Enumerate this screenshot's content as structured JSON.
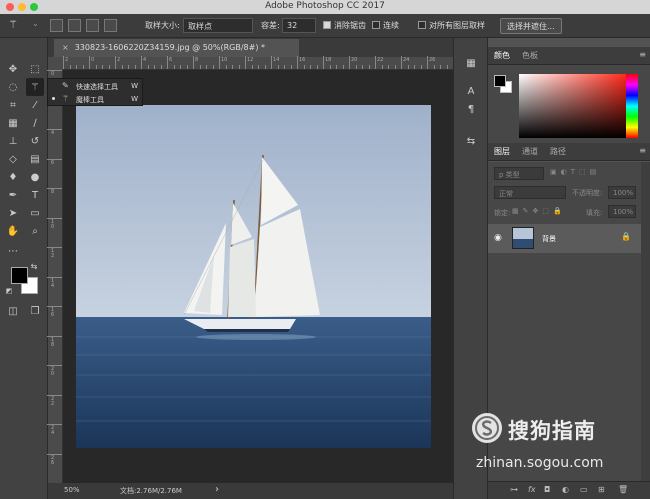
{
  "window": {
    "title": "Adobe Photoshop CC 2017",
    "traffic_colors": [
      "#fd5d57",
      "#febb2e",
      "#2ac840"
    ]
  },
  "options_bar": {
    "sample_size_label": "取样大小:",
    "sample_size_value": "取样点",
    "tolerance_label": "容差:",
    "tolerance_value": "32",
    "antialias_label": "消除锯齿",
    "antialias_checked": true,
    "contiguous_label": "连续",
    "all_layers_label": "对所有图层取样",
    "select_subject_label": "选择并遮住..."
  },
  "flyout": {
    "items": [
      {
        "label": "快速选择工具",
        "shortcut": "W",
        "icon": "quick-selection-icon"
      },
      {
        "label": "魔棒工具",
        "shortcut": "W",
        "icon": "magic-wand-icon"
      }
    ]
  },
  "document": {
    "tab_label": "330823-1606220Z34159.jpg @ 50%(RGB/8#) *",
    "close_glyph": "×",
    "ruler_h_labels": [
      "2",
      "0",
      "2",
      "4",
      "6",
      "8",
      "10",
      "12",
      "14",
      "16",
      "18",
      "20",
      "22",
      "24",
      "26"
    ],
    "ruler_v_labels": [
      "0",
      "2",
      "4",
      "6",
      "8",
      "1 0",
      "1 2",
      "1 4",
      "1 6",
      "1 8",
      "2 0",
      "2 2",
      "2 4",
      "2 6"
    ]
  },
  "status": {
    "zoom": "50%",
    "doc_info": "文档:2.76M/2.76M",
    "arrow": "›"
  },
  "color_panel": {
    "tabs": [
      "颜色",
      "色板"
    ],
    "foreground": "#000000",
    "background": "#ffffff"
  },
  "layers_panel": {
    "tabs": [
      "图层",
      "通道",
      "路径"
    ],
    "filter_label": "p 类型",
    "blend_mode": "正常",
    "opacity_label": "不透明度:",
    "opacity_value": "100%",
    "lock_label": "锁定:",
    "fill_label": "填充:",
    "fill_value": "100%",
    "layer_name": "背景",
    "bottom_icons": [
      "link-icon",
      "fx-icon",
      "mask-icon",
      "adjustment-icon",
      "group-icon",
      "new-layer-icon",
      "trash-icon"
    ],
    "bottom_fx": "fx"
  },
  "watermark": {
    "title": "搜狗指南",
    "url": "zhinan.sogou.com"
  }
}
